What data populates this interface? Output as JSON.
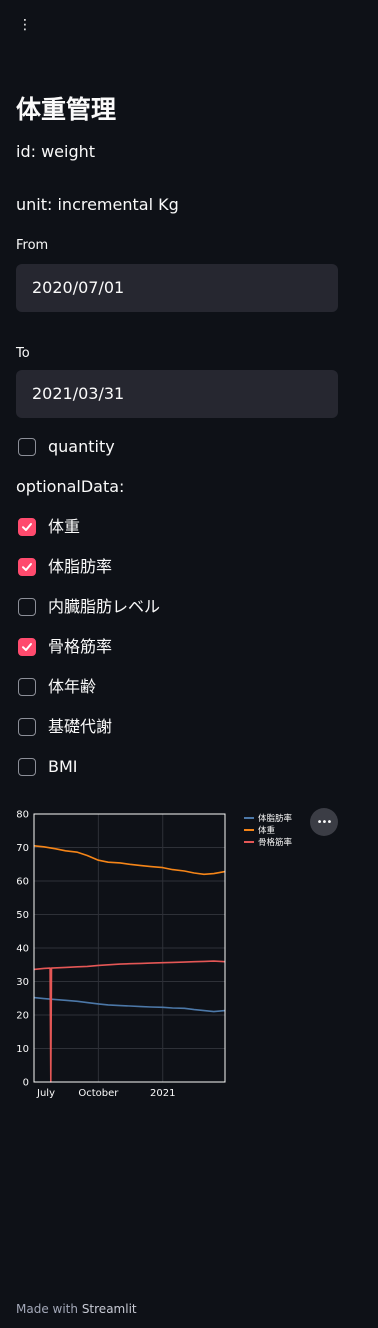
{
  "menu": {
    "icon": "vertical-ellipsis-icon",
    "glyph": "⋮"
  },
  "page": {
    "title": "体重管理",
    "id_line": "id: weight",
    "unit_line": "unit: incremental Kg"
  },
  "from": {
    "label": "From",
    "value": "2020/07/01"
  },
  "to": {
    "label": "To",
    "value": "2021/03/31"
  },
  "quantity": {
    "label": "quantity",
    "checked": false
  },
  "optional": {
    "label": "optionalData:",
    "items": [
      {
        "label": "体重",
        "checked": true
      },
      {
        "label": "体脂肪率",
        "checked": true
      },
      {
        "label": "内臓脂肪レベル",
        "checked": false
      },
      {
        "label": "骨格筋率",
        "checked": true
      },
      {
        "label": "体年齢",
        "checked": false
      },
      {
        "label": "基礎代謝",
        "checked": false
      },
      {
        "label": "BMI",
        "checked": false
      }
    ]
  },
  "colors": {
    "accent": "#ff4b6e",
    "series_body_fat": "#4c78a8",
    "series_weight": "#f58518",
    "series_muscle": "#e45756"
  },
  "chart_data": {
    "type": "line",
    "xlabel": "",
    "ylabel": "",
    "ylim": [
      0,
      80
    ],
    "x_range": [
      "2020-07-01",
      "2021-03-31"
    ],
    "yticks": [
      0,
      10,
      20,
      30,
      40,
      50,
      60,
      70,
      80
    ],
    "xticks": [
      {
        "label": "July",
        "date": "2020-07-01"
      },
      {
        "label": "October",
        "date": "2020-10-01"
      },
      {
        "label": "2021",
        "date": "2021-01-01"
      }
    ],
    "grid": true,
    "legend": "top-right, outside plot",
    "series": [
      {
        "name": "体脂肪率",
        "color": "#4c78a8",
        "points": [
          [
            "2020-07-01",
            25.2
          ],
          [
            "2020-07-15",
            24.9
          ],
          [
            "2020-08-01",
            24.6
          ],
          [
            "2020-08-15",
            24.4
          ],
          [
            "2020-09-01",
            24.1
          ],
          [
            "2020-09-15",
            23.7
          ],
          [
            "2020-10-01",
            23.3
          ],
          [
            "2020-10-15",
            23.0
          ],
          [
            "2020-11-01",
            22.8
          ],
          [
            "2020-11-15",
            22.7
          ],
          [
            "2020-12-01",
            22.5
          ],
          [
            "2020-12-15",
            22.4
          ],
          [
            "2021-01-01",
            22.3
          ],
          [
            "2021-01-15",
            22.1
          ],
          [
            "2021-02-01",
            22.0
          ],
          [
            "2021-02-15",
            21.6
          ],
          [
            "2021-03-01",
            21.3
          ],
          [
            "2021-03-15",
            21.0
          ],
          [
            "2021-03-31",
            21.3
          ]
        ]
      },
      {
        "name": "体重",
        "color": "#f58518",
        "points": [
          [
            "2020-07-01",
            70.5
          ],
          [
            "2020-07-15",
            70.2
          ],
          [
            "2020-08-01",
            69.6
          ],
          [
            "2020-08-15",
            69.0
          ],
          [
            "2020-09-01",
            68.6
          ],
          [
            "2020-09-15",
            67.6
          ],
          [
            "2020-10-01",
            66.2
          ],
          [
            "2020-10-15",
            65.6
          ],
          [
            "2020-11-01",
            65.4
          ],
          [
            "2020-11-15",
            65.0
          ],
          [
            "2020-12-01",
            64.6
          ],
          [
            "2020-12-15",
            64.3
          ],
          [
            "2021-01-01",
            64.0
          ],
          [
            "2021-01-15",
            63.4
          ],
          [
            "2021-02-01",
            63.0
          ],
          [
            "2021-02-15",
            62.4
          ],
          [
            "2021-03-01",
            62.0
          ],
          [
            "2021-03-15",
            62.2
          ],
          [
            "2021-03-31",
            62.8
          ]
        ]
      },
      {
        "name": "骨格筋率",
        "color": "#e45756",
        "points": [
          [
            "2020-07-01",
            33.6
          ],
          [
            "2020-07-15",
            33.9
          ],
          [
            "2020-07-24",
            34.0
          ],
          [
            "2020-07-25",
            0.0
          ],
          [
            "2020-07-26",
            34.0
          ],
          [
            "2020-08-15",
            34.2
          ],
          [
            "2020-09-01",
            34.4
          ],
          [
            "2020-09-15",
            34.5
          ],
          [
            "2020-10-01",
            34.8
          ],
          [
            "2020-10-15",
            35.0
          ],
          [
            "2020-11-01",
            35.2
          ],
          [
            "2020-11-15",
            35.3
          ],
          [
            "2020-12-01",
            35.4
          ],
          [
            "2020-12-15",
            35.5
          ],
          [
            "2021-01-01",
            35.6
          ],
          [
            "2021-01-15",
            35.7
          ],
          [
            "2021-02-01",
            35.8
          ],
          [
            "2021-02-15",
            35.9
          ],
          [
            "2021-03-01",
            36.0
          ],
          [
            "2021-03-15",
            36.1
          ],
          [
            "2021-03-31",
            35.9
          ]
        ]
      }
    ]
  },
  "chart_menu": {
    "icon": "more-options-icon",
    "glyph": "•••"
  },
  "footer": {
    "prefix": "Made with",
    "brand": "Streamlit"
  }
}
